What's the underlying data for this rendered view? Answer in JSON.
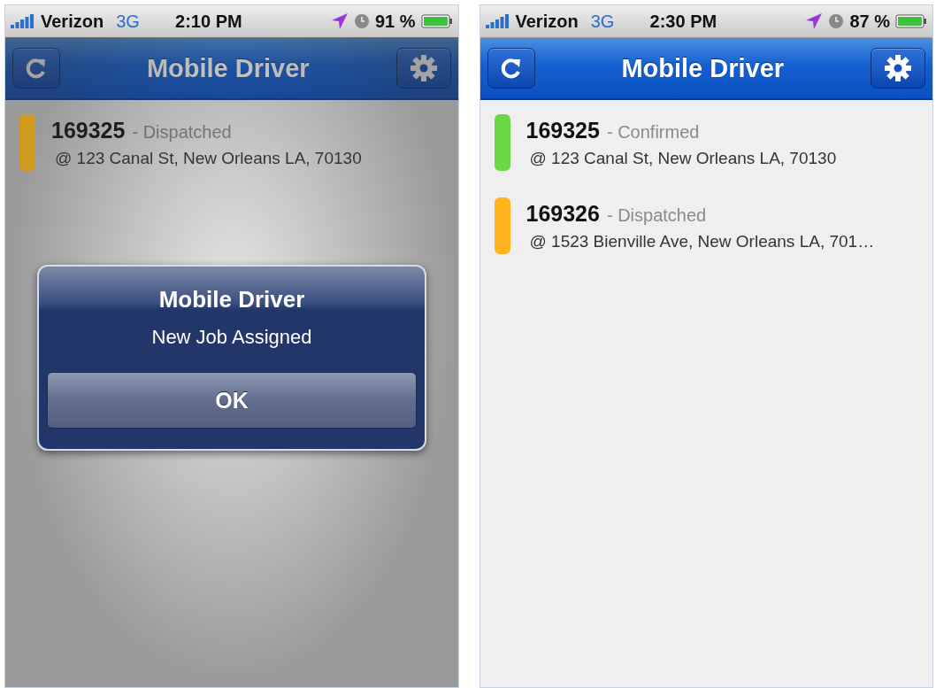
{
  "screens": [
    {
      "status_bar": {
        "carrier": "Verizon",
        "network": "3G",
        "time": "2:10 PM",
        "battery": "91 %"
      },
      "nav": {
        "title": "Mobile Driver"
      },
      "jobs": [
        {
          "number": "169325",
          "status": "- Dispatched",
          "address": "@ 123 Canal St, New Orleans LA, 70130",
          "color": "#d09a1c"
        }
      ],
      "alert": {
        "title": "Mobile Driver",
        "message": "New Job Assigned",
        "button": "OK"
      }
    },
    {
      "status_bar": {
        "carrier": "Verizon",
        "network": "3G",
        "time": "2:30 PM",
        "battery": "87 %"
      },
      "nav": {
        "title": "Mobile Driver"
      },
      "jobs": [
        {
          "number": "169325",
          "status": "- Confirmed",
          "address": "@ 123 Canal St, New Orleans LA, 70130",
          "color": "#6ad844"
        },
        {
          "number": "169326",
          "status": "- Dispatched",
          "address": "@ 1523 Bienville Ave, New Orleans LA, 701…",
          "color": "#ffb41e"
        }
      ]
    }
  ]
}
